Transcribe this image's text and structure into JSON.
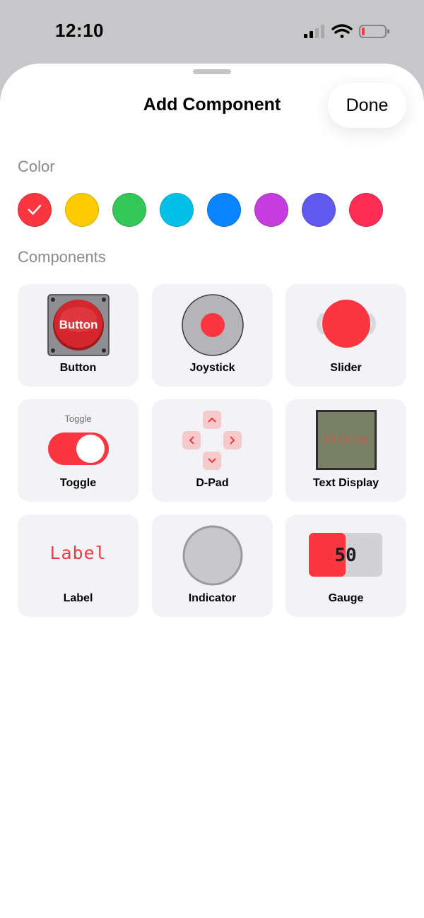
{
  "status_bar": {
    "time": "12:10"
  },
  "sheet": {
    "title": "Add Component",
    "done_label": "Done"
  },
  "color_section": {
    "label": "Color",
    "swatches": [
      {
        "color": "#fb3640",
        "selected": true
      },
      {
        "color": "#fecb00"
      },
      {
        "color": "#33c758"
      },
      {
        "color": "#02c0e7"
      },
      {
        "color": "#0a84ff"
      },
      {
        "color": "#c63cdf"
      },
      {
        "color": "#5f59ef"
      },
      {
        "color": "#fe2d55"
      }
    ]
  },
  "components_section": {
    "label": "Components",
    "tiles": [
      {
        "label": "Button",
        "preview_text": "Button",
        "icon": "arcade-button-icon"
      },
      {
        "label": "Joystick",
        "icon": "joystick-icon"
      },
      {
        "label": "Slider",
        "icon": "slider-knob-icon"
      },
      {
        "label": "Toggle",
        "preview_text": "Toggle",
        "icon": "toggle-switch-icon"
      },
      {
        "label": "D-Pad",
        "icon": "dpad-icon"
      },
      {
        "label": "Text Display",
        "preview_text": "Display",
        "icon": "lcd-display-icon"
      },
      {
        "label": "Label",
        "preview_text": "Label",
        "icon": "dot-matrix-label-icon"
      },
      {
        "label": "Indicator",
        "icon": "indicator-light-icon"
      },
      {
        "label": "Gauge",
        "preview_text": "50",
        "value": 50,
        "icon": "gauge-icon"
      }
    ]
  },
  "accent_color": "#fb3640"
}
